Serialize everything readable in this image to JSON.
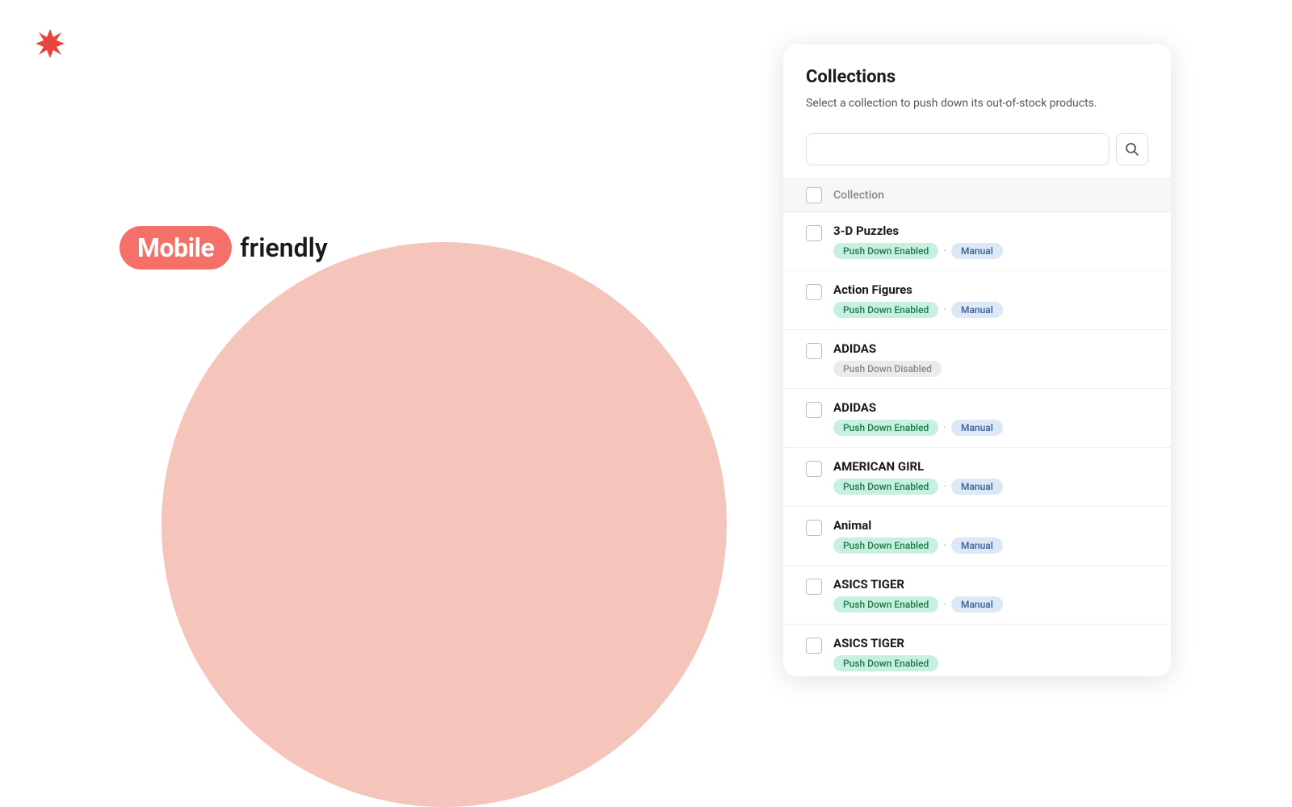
{
  "logo": {
    "alt": "App logo"
  },
  "tagline": {
    "mobile": "Mobile",
    "friendly": "friendly"
  },
  "panel": {
    "title": "Collections",
    "subtitle": "Select a collection to push down its out-of-stock products.",
    "search": {
      "placeholder": "",
      "button_icon": "🔍"
    },
    "header_column": "Collection",
    "items": [
      {
        "name": "3-D Puzzles",
        "status": "Push Down Enabled",
        "status_type": "enabled",
        "mode": "Manual",
        "mode_type": "manual"
      },
      {
        "name": "Action Figures",
        "status": "Push Down Enabled",
        "status_type": "enabled",
        "mode": "Manual",
        "mode_type": "manual"
      },
      {
        "name": "ADIDAS",
        "status": "Push Down Disabled",
        "status_type": "disabled",
        "mode": null,
        "mode_type": null
      },
      {
        "name": "ADIDAS",
        "status": "Push Down Enabled",
        "status_type": "enabled",
        "mode": "Manual",
        "mode_type": "manual"
      },
      {
        "name": "AMERICAN GIRL",
        "status": "Push Down Enabled",
        "status_type": "enabled",
        "mode": "Manual",
        "mode_type": "manual"
      },
      {
        "name": "Animal",
        "status": "Push Down Enabled",
        "status_type": "enabled",
        "mode": "Manual",
        "mode_type": "manual"
      },
      {
        "name": "ASICS TIGER",
        "status": "Push Down Enabled",
        "status_type": "enabled",
        "mode": "Manual",
        "mode_type": "manual"
      },
      {
        "name": "ASICS TIGER",
        "status": "Push Down Enabled",
        "status_type": "enabled",
        "mode": null,
        "mode_type": null,
        "partial": true
      }
    ]
  },
  "colors": {
    "logo_primary": "#e8453c",
    "mobile_badge": "#f47068"
  }
}
